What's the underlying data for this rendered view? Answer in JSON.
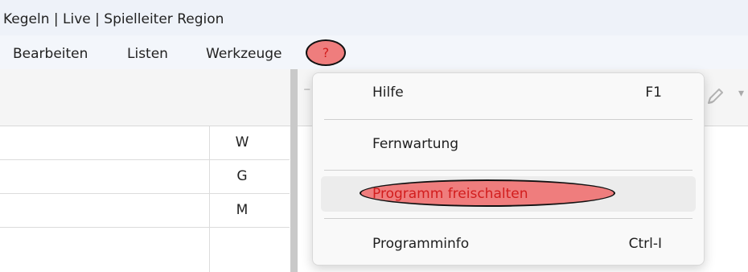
{
  "window": {
    "title": "Kegeln | Live | Spielleiter Region"
  },
  "menubar": {
    "items": [
      "Bearbeiten",
      "Listen",
      "Werkzeuge"
    ],
    "help_label": "?"
  },
  "grid": {
    "cells": [
      "W",
      "G",
      "M",
      ""
    ]
  },
  "help_menu": {
    "items": [
      {
        "label": "Hilfe",
        "shortcut": "F1"
      },
      {
        "label": "Fernwartung",
        "shortcut": ""
      },
      {
        "label": "Programm freischalten",
        "shortcut": ""
      },
      {
        "label": "Programminfo",
        "shortcut": "Ctrl-I"
      }
    ]
  },
  "colors": {
    "highlight_fill": "#ef7d7d",
    "highlight_text": "#d21d1d",
    "titlebar_bg": "#eef2f9"
  },
  "icons": [
    "edit-icon",
    "chevron-down-icon"
  ]
}
